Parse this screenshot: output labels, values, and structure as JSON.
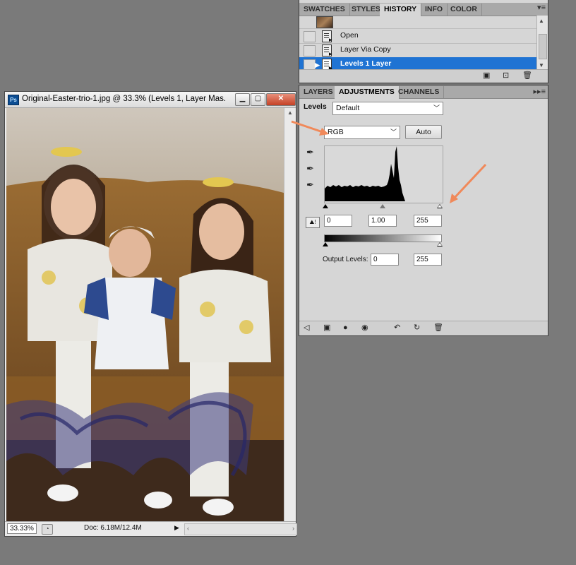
{
  "history_panel": {
    "tabs": [
      "SWATCHES",
      "STYLES",
      "HISTORY",
      "INFO",
      "COLOR"
    ],
    "active_tab": "HISTORY",
    "items": [
      {
        "label": "Open",
        "selected": false
      },
      {
        "label": "Layer Via Copy",
        "selected": false
      },
      {
        "label": "Levels 1 Layer",
        "selected": true
      }
    ]
  },
  "adjustments_panel": {
    "tabs": [
      "LAYERS",
      "ADJUSTMENTS",
      "CHANNELS"
    ],
    "active_tab": "ADJUSTMENTS",
    "title": "Levels",
    "preset": "Default",
    "channel": "RGB",
    "auto_label": "Auto",
    "input_levels": {
      "black": "0",
      "gamma": "1.00",
      "white": "255"
    },
    "output_label": "Output Levels:",
    "output_levels": {
      "black": "0",
      "white": "255"
    }
  },
  "document": {
    "title": "Original-Easter-trio-1.jpg @ 33.3% (Levels 1, Layer Mas...",
    "zoom": "33.33%",
    "doc_size": "Doc: 6.18M/12.4M"
  },
  "colors": {
    "selection_blue": "#1f73d3",
    "annotation_arrow": "#f0895a",
    "panel_bg": "#d6d6d6",
    "workspace_bg": "#7a7a7a"
  }
}
